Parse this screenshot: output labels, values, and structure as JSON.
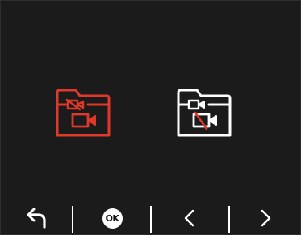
{
  "colors": {
    "background": "#1b1b1b",
    "selected_accent": "#e0392b",
    "unselected": "#ffffff",
    "divider": "#ffffff"
  },
  "folders": [
    {
      "icon": "locked-video-folder-icon",
      "state": "selected",
      "color": "#e0392b"
    },
    {
      "icon": "unlock-video-folder-icon",
      "state": "unselected",
      "color": "#ffffff"
    }
  ],
  "bottom_bar": {
    "back_icon": "return-arrow-icon",
    "ok_label": "OK",
    "prev_icon": "chevron-left-icon",
    "next_icon": "chevron-right-icon"
  }
}
